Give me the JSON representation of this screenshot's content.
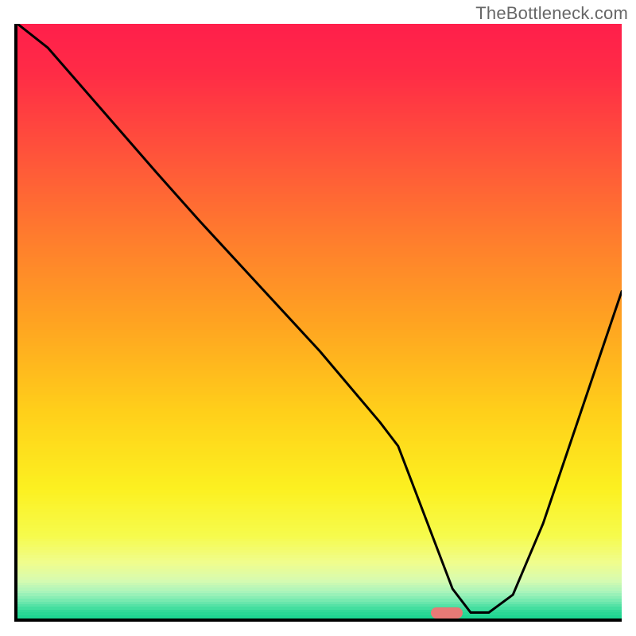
{
  "watermark": "TheBottleneck.com",
  "chart_data": {
    "type": "line",
    "title": "",
    "xlabel": "",
    "ylabel": "",
    "xlim": [
      0,
      100
    ],
    "ylim": [
      0,
      100
    ],
    "grid": false,
    "series": [
      {
        "name": "curve",
        "x": [
          0,
          5,
          17,
          23,
          30,
          40,
          50,
          60,
          63,
          66,
          72,
          75,
          78,
          82,
          87,
          92,
          97,
          100
        ],
        "values": [
          100,
          96,
          82,
          75,
          67,
          56,
          45,
          33,
          29,
          21,
          5,
          1,
          1,
          4,
          16,
          31,
          46,
          55
        ]
      }
    ],
    "marker": {
      "x": 71,
      "y": 1
    },
    "gradient_stops": [
      {
        "pos": 0.0,
        "color": "#ff1f4b"
      },
      {
        "pos": 0.08,
        "color": "#ff2b46"
      },
      {
        "pos": 0.2,
        "color": "#ff4e3c"
      },
      {
        "pos": 0.35,
        "color": "#ff7a2e"
      },
      {
        "pos": 0.5,
        "color": "#ffa321"
      },
      {
        "pos": 0.65,
        "color": "#ffcf1a"
      },
      {
        "pos": 0.78,
        "color": "#fcf020"
      },
      {
        "pos": 0.86,
        "color": "#f6fb4c"
      },
      {
        "pos": 0.905,
        "color": "#f0fd8d"
      },
      {
        "pos": 0.935,
        "color": "#d7fbb0"
      },
      {
        "pos": 0.955,
        "color": "#a7f4bb"
      },
      {
        "pos": 0.972,
        "color": "#6ae7ad"
      },
      {
        "pos": 0.986,
        "color": "#33da99"
      },
      {
        "pos": 1.0,
        "color": "#16d48e"
      }
    ]
  }
}
